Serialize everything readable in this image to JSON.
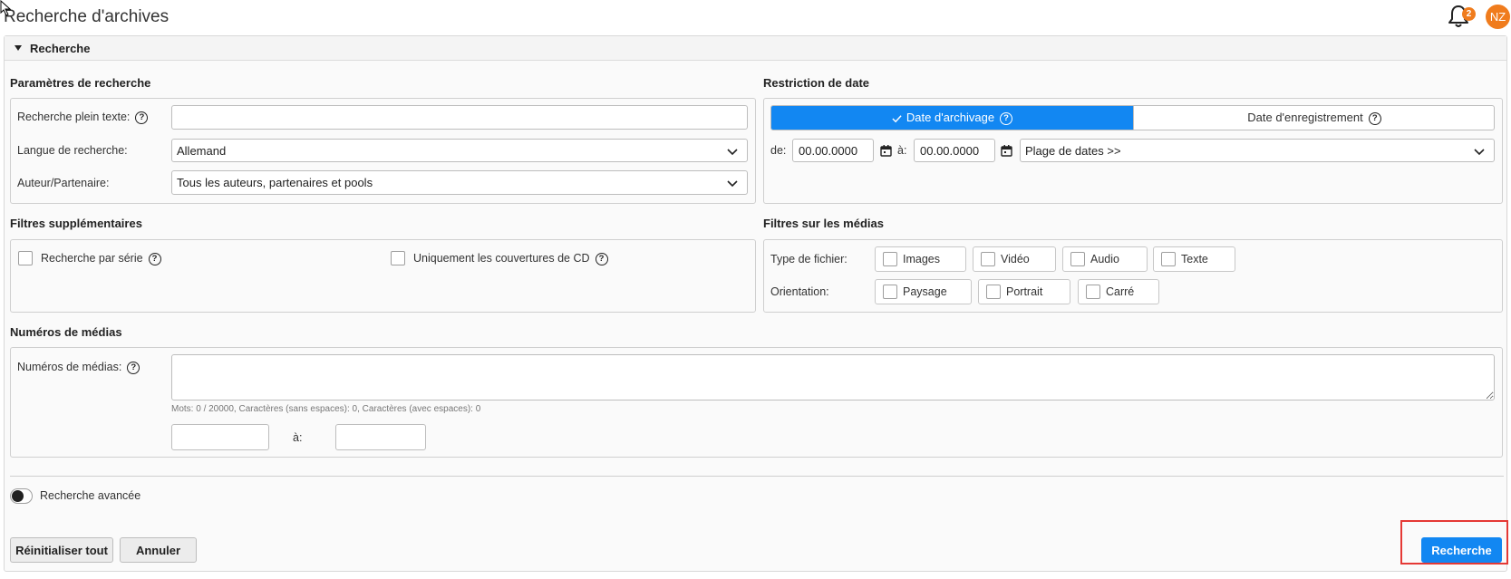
{
  "page": {
    "title": "Recherche d'archives"
  },
  "header": {
    "notification_count": "2",
    "avatar_initials": "NZ"
  },
  "panel": {
    "title": "Recherche"
  },
  "search_params": {
    "section_title": "Paramètres de recherche",
    "fulltext_label": "Recherche plein texte:",
    "fulltext_value": "",
    "language_label": "Langue de recherche:",
    "language_value": "Allemand",
    "author_label": "Auteur/Partenaire:",
    "author_value": "Tous les auteurs, partenaires et pools"
  },
  "date_restriction": {
    "section_title": "Restriction de date",
    "tab_archive": "Date d'archivage",
    "tab_record": "Date d'enregistrement",
    "from_label": "de:",
    "from_value": "00.00.0000",
    "to_label": "à:",
    "to_value": "00.00.0000",
    "range_value": "Plage de dates >>"
  },
  "extra_filters": {
    "section_title": "Filtres supplémentaires",
    "series_label": "Recherche par série",
    "cd_label": "Uniquement les couvertures de CD"
  },
  "media_filters": {
    "section_title": "Filtres sur les médias",
    "filetype_label": "Type de fichier:",
    "filetypes": [
      "Images",
      "Vidéo",
      "Audio",
      "Texte"
    ],
    "orientation_label": "Orientation:",
    "orientations": [
      "Paysage",
      "Portrait",
      "Carré"
    ]
  },
  "media_numbers": {
    "section_title": "Numéros de médias",
    "label": "Numéros de médias:",
    "counter": "Mots: 0 / 20000, Caractères (sans espaces): 0, Caractères (avec espaces): 0",
    "range_to_label": "à:"
  },
  "advanced": {
    "label": "Recherche avancée"
  },
  "footer": {
    "reset_label": "Réinitialiser tout",
    "cancel_label": "Annuler",
    "search_label": "Recherche"
  },
  "colors": {
    "primary": "#1287f2",
    "accent": "#f07c1d",
    "highlight": "#e53935"
  }
}
